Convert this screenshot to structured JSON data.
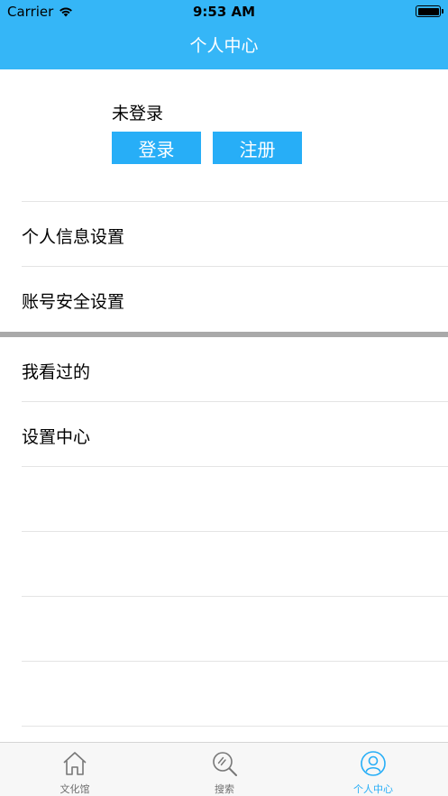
{
  "status_bar": {
    "carrier": "Carrier",
    "time": "9:53 AM"
  },
  "nav": {
    "title": "个人中心"
  },
  "profile": {
    "name": "未登录",
    "login_label": "登录",
    "register_label": "注册"
  },
  "menu": {
    "section1": [
      {
        "label": "个人信息设置"
      },
      {
        "label": "账号安全设置"
      }
    ],
    "section2": [
      {
        "label": "我看过的"
      },
      {
        "label": "设置中心"
      }
    ]
  },
  "tab_bar": {
    "items": [
      {
        "label": "文化馆",
        "icon": "home-icon"
      },
      {
        "label": "搜索",
        "icon": "search-icon"
      },
      {
        "label": "个人中心",
        "icon": "user-icon"
      }
    ],
    "active_index": 2
  },
  "colors": {
    "primary": "#35b6f7",
    "button": "#27aef7",
    "active_tab": "#27aef7",
    "inactive_tab": "#6f6f6f",
    "separator": "#a9a9a9",
    "divider": "#e4e4e4"
  }
}
